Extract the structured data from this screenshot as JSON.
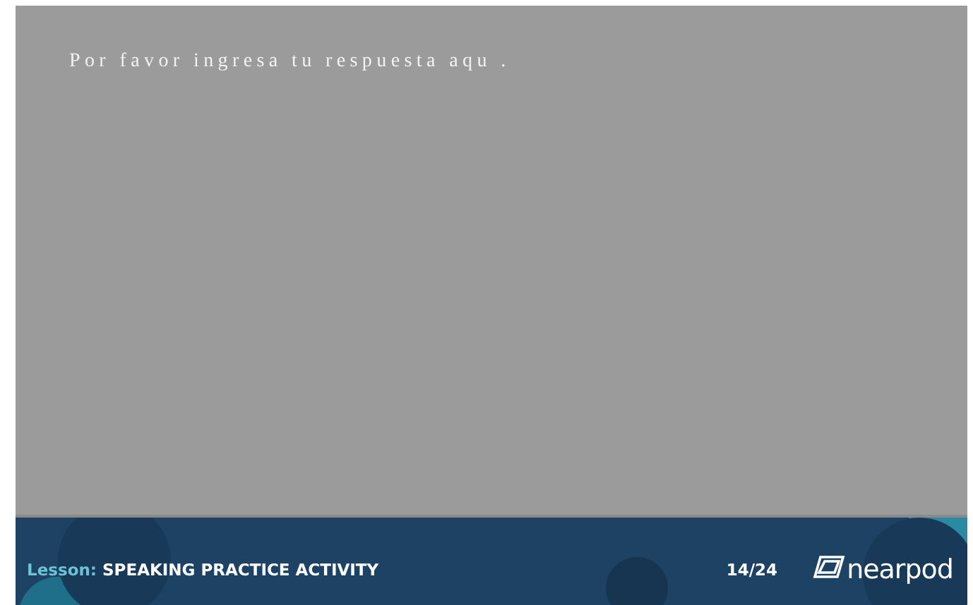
{
  "slide": {
    "prompt": "Por favor ingresa tu respuesta aqu ."
  },
  "footer": {
    "lesson_label": "Lesson:",
    "lesson_title": "SPEAKING PRACTICE ACTIVITY",
    "page_counter": "14/24",
    "logo_text": "nearpod"
  }
}
